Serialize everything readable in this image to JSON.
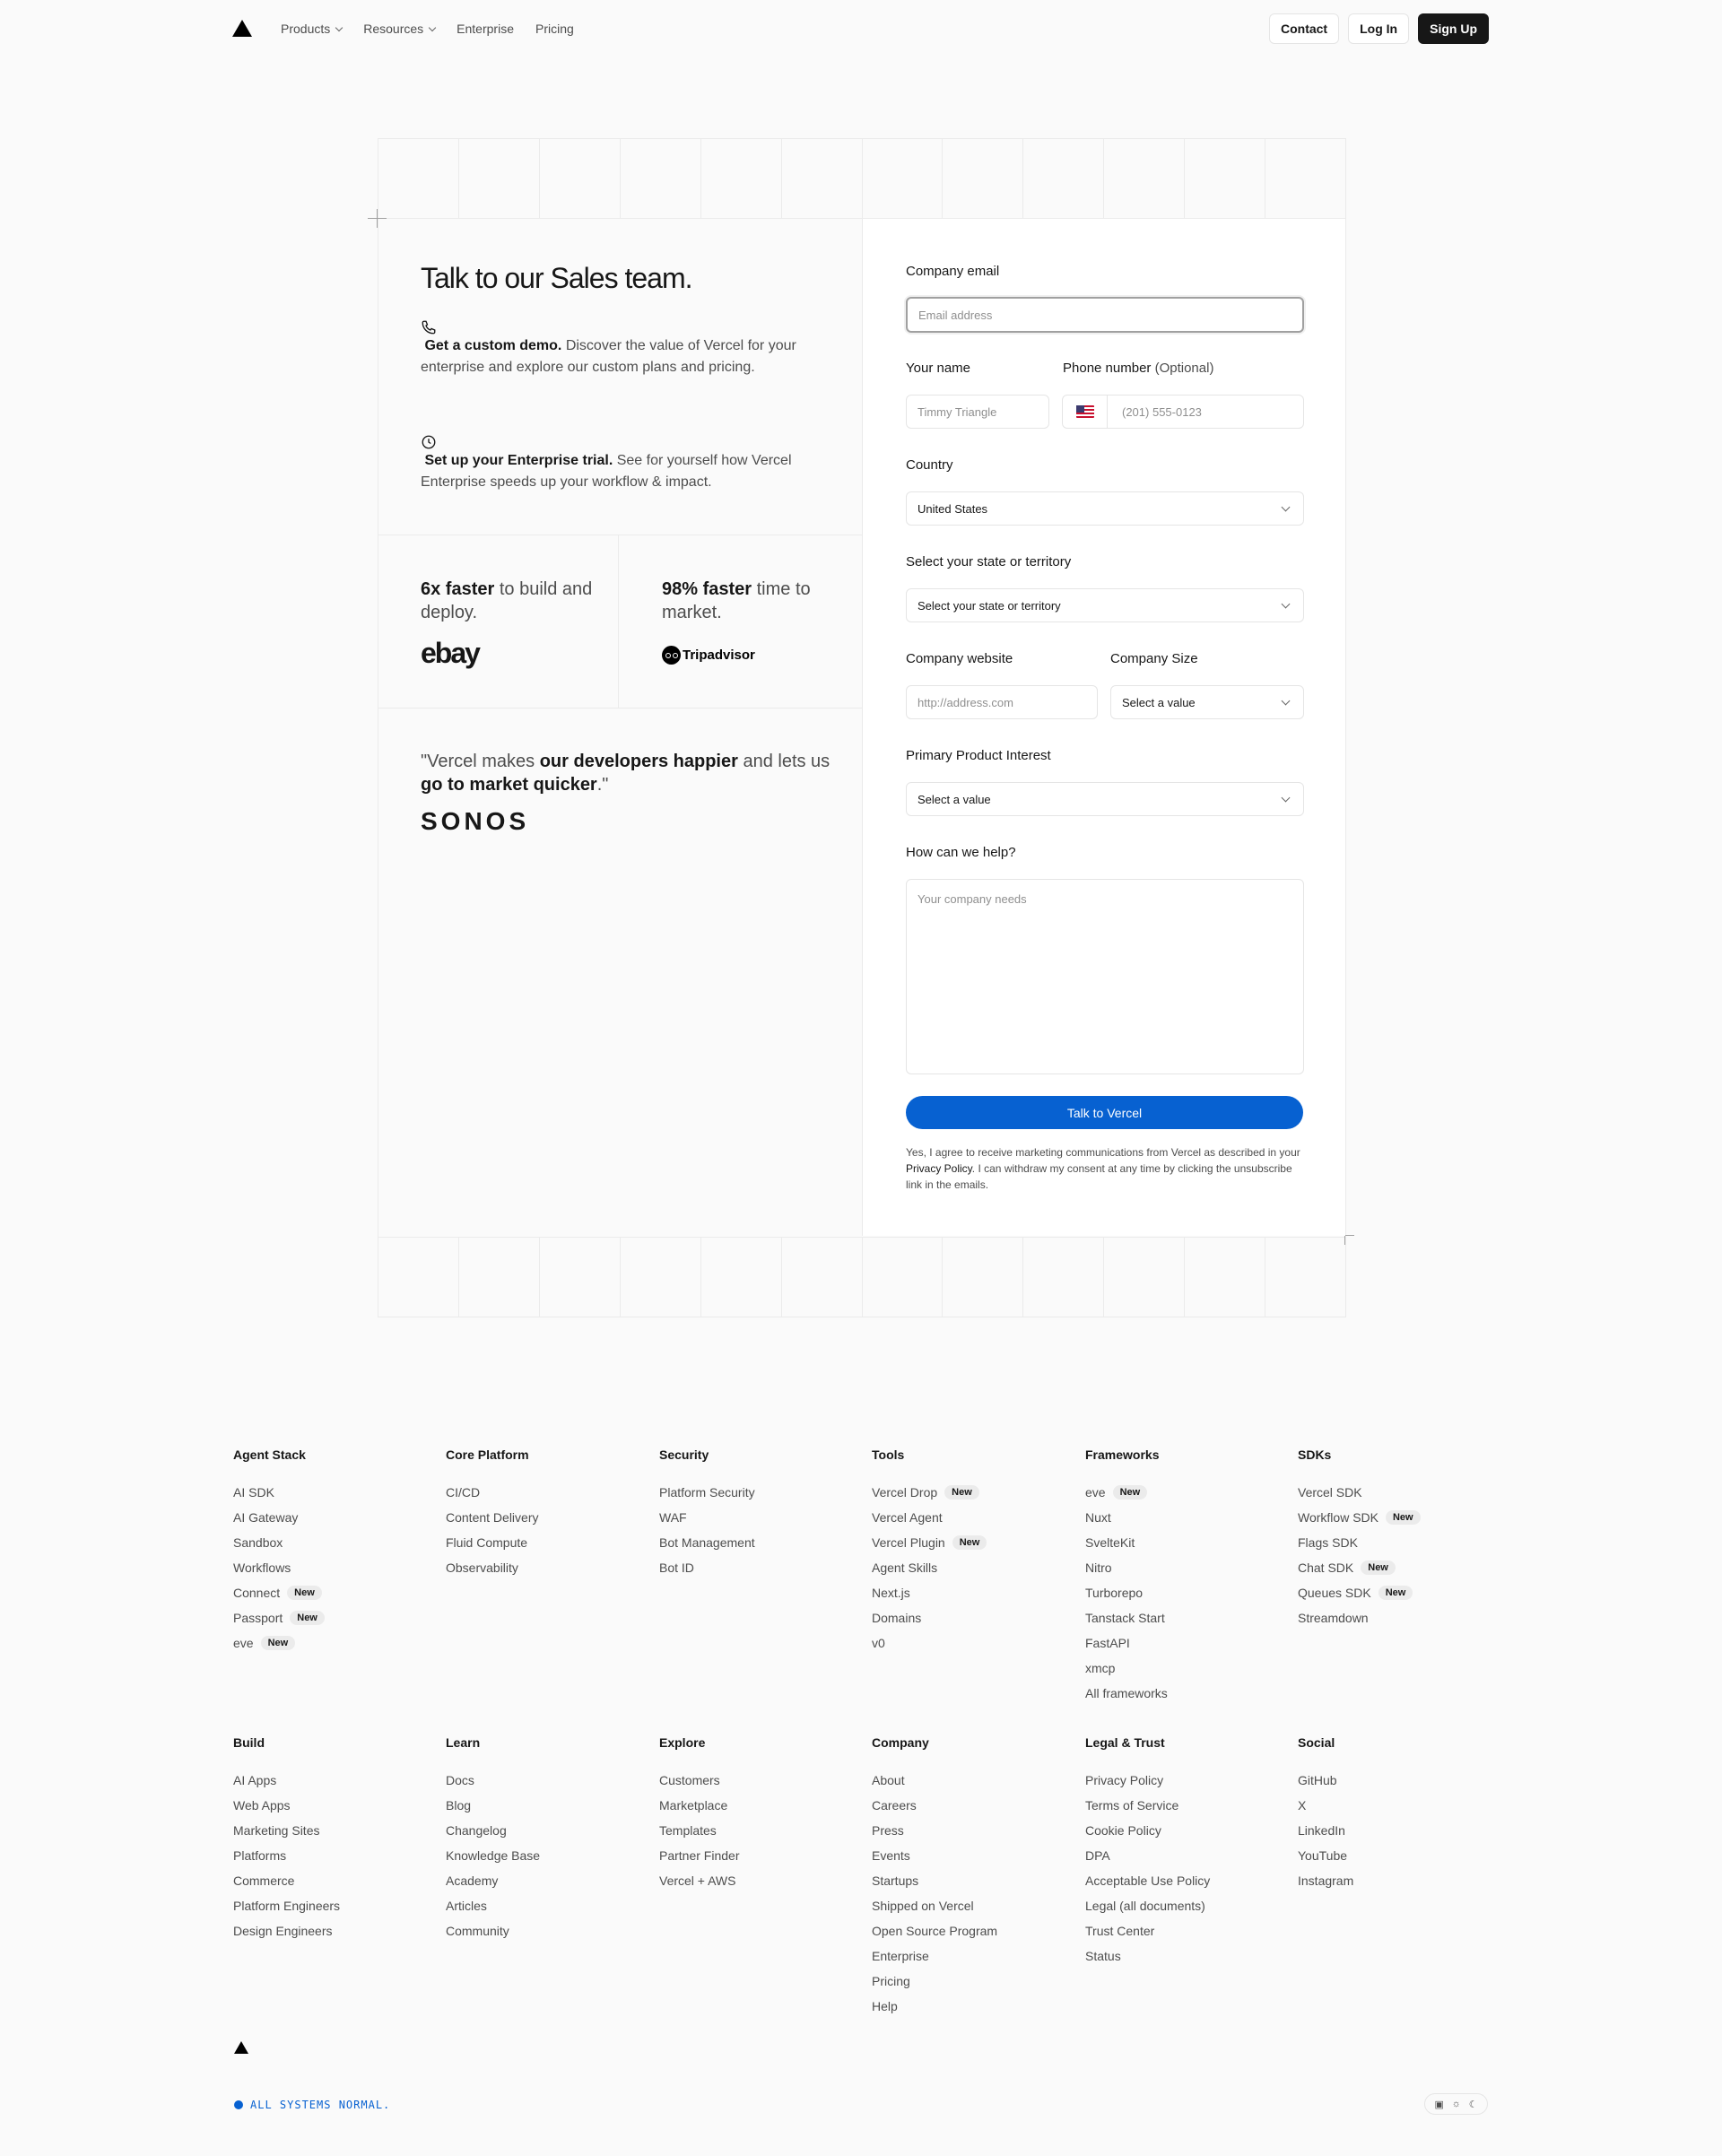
{
  "nav": {
    "items": [
      {
        "label": "Products",
        "has_menu": true
      },
      {
        "label": "Resources",
        "has_menu": true
      },
      {
        "label": "Enterprise",
        "has_menu": false
      },
      {
        "label": "Pricing",
        "has_menu": false
      }
    ],
    "contact": "Contact",
    "login": "Log In",
    "signup": "Sign Up"
  },
  "hero": {
    "title": "Talk to our Sales team.",
    "feature1_bold": "Get a custom demo.",
    "feature1_text": " Discover the value of Vercel for your enterprise and explore our custom plans and pricing.",
    "feature2_bold": "Set up your Enterprise trial.",
    "feature2_text": " See for yourself how Vercel Enterprise speeds up your workflow & impact.",
    "stat1_bold": "6x faster",
    "stat1_text": " to build and deploy.",
    "stat1_logo": "ebay",
    "stat2_bold": "98% faster",
    "stat2_text": " time to market.",
    "stat2_logo": "Tripadvisor",
    "quote_a": "\"Vercel makes ",
    "quote_b": "our developers happier",
    "quote_c": " and lets us ",
    "quote_d": "go to market quicker",
    "quote_e": ".\"",
    "quote_logo": "SONOS"
  },
  "form": {
    "email_label": "Company email",
    "email_placeholder": "Email address",
    "name_label": "Your name",
    "name_placeholder": "Timmy Triangle",
    "phone_label": "Phone number",
    "phone_optional": "(Optional)",
    "phone_placeholder": "(201) 555-0123",
    "country_label": "Country",
    "country_value": "United States",
    "state_label": "Select your state or territory",
    "state_placeholder": "Select your state or territory",
    "website_label": "Company website",
    "website_placeholder": "http://address.com",
    "size_label": "Company Size",
    "size_placeholder": "Select a value",
    "product_label": "Primary Product Interest",
    "product_placeholder": "Select a value",
    "help_label": "How can we help?",
    "help_placeholder": "Your company needs",
    "submit": "Talk to Vercel",
    "legal_a": "Yes, I agree to receive marketing communications from Vercel as described in your ",
    "legal_link": "Privacy Policy",
    "legal_b": ". I can withdraw my consent at any time by clicking the unsubscribe link in the emails."
  },
  "footer": {
    "columns": [
      {
        "title": "Agent Stack",
        "items": [
          {
            "label": "AI SDK"
          },
          {
            "label": "AI Gateway"
          },
          {
            "label": "Sandbox"
          },
          {
            "label": "Workflows"
          },
          {
            "label": "Connect",
            "badge": "New"
          },
          {
            "label": "Passport",
            "badge": "New"
          },
          {
            "label": "eve",
            "badge": "New"
          }
        ]
      },
      {
        "title": "Core Platform",
        "items": [
          {
            "label": "CI/CD"
          },
          {
            "label": "Content Delivery"
          },
          {
            "label": "Fluid Compute"
          },
          {
            "label": "Observability"
          }
        ]
      },
      {
        "title": "Security",
        "items": [
          {
            "label": "Platform Security"
          },
          {
            "label": "WAF"
          },
          {
            "label": "Bot Management"
          },
          {
            "label": "Bot ID"
          }
        ]
      },
      {
        "title": "Tools",
        "items": [
          {
            "label": "Vercel Drop",
            "badge": "New"
          },
          {
            "label": "Vercel Agent"
          },
          {
            "label": "Vercel Plugin",
            "badge": "New"
          },
          {
            "label": "Agent Skills"
          },
          {
            "label": "Next.js"
          },
          {
            "label": "Domains"
          },
          {
            "label": "v0"
          }
        ]
      },
      {
        "title": "Frameworks",
        "items": [
          {
            "label": "eve",
            "badge": "New"
          },
          {
            "label": "Nuxt"
          },
          {
            "label": "SvelteKit"
          },
          {
            "label": "Nitro"
          },
          {
            "label": "Turborepo"
          },
          {
            "label": "Tanstack Start"
          },
          {
            "label": "FastAPI"
          },
          {
            "label": "xmcp"
          },
          {
            "label": "All frameworks"
          }
        ]
      },
      {
        "title": "SDKs",
        "items": [
          {
            "label": "Vercel SDK"
          },
          {
            "label": "Workflow SDK",
            "badge": "New"
          },
          {
            "label": "Flags SDK"
          },
          {
            "label": "Chat SDK",
            "badge": "New"
          },
          {
            "label": "Queues SDK",
            "badge": "New"
          },
          {
            "label": "Streamdown"
          }
        ]
      },
      {
        "title": "Build",
        "items": [
          {
            "label": "AI Apps"
          },
          {
            "label": "Web Apps"
          },
          {
            "label": "Marketing Sites"
          },
          {
            "label": "Platforms"
          },
          {
            "label": "Commerce"
          },
          {
            "label": "Platform Engineers"
          },
          {
            "label": "Design Engineers"
          }
        ]
      },
      {
        "title": "Learn",
        "items": [
          {
            "label": "Docs"
          },
          {
            "label": "Blog"
          },
          {
            "label": "Changelog"
          },
          {
            "label": "Knowledge Base"
          },
          {
            "label": "Academy"
          },
          {
            "label": "Articles"
          },
          {
            "label": "Community"
          }
        ]
      },
      {
        "title": "Explore",
        "items": [
          {
            "label": "Customers"
          },
          {
            "label": "Marketplace"
          },
          {
            "label": "Templates"
          },
          {
            "label": "Partner Finder"
          },
          {
            "label": "Vercel + AWS"
          }
        ]
      },
      {
        "title": "Company",
        "items": [
          {
            "label": "About"
          },
          {
            "label": "Careers"
          },
          {
            "label": "Press"
          },
          {
            "label": "Events"
          },
          {
            "label": "Startups"
          },
          {
            "label": "Shipped on Vercel"
          },
          {
            "label": "Open Source Program"
          },
          {
            "label": "Enterprise"
          },
          {
            "label": "Pricing"
          },
          {
            "label": "Help"
          }
        ]
      },
      {
        "title": "Legal & Trust",
        "items": [
          {
            "label": "Privacy Policy"
          },
          {
            "label": "Terms of Service"
          },
          {
            "label": "Cookie Policy"
          },
          {
            "label": "DPA"
          },
          {
            "label": "Acceptable Use Policy"
          },
          {
            "label": "Legal (all documents)"
          },
          {
            "label": "Trust Center"
          },
          {
            "label": "Status"
          }
        ]
      },
      {
        "title": "Social",
        "items": [
          {
            "label": "GitHub"
          },
          {
            "label": "X"
          },
          {
            "label": "LinkedIn"
          },
          {
            "label": "YouTube"
          },
          {
            "label": "Instagram"
          }
        ]
      }
    ],
    "status": "ALL SYSTEMS NORMAL.",
    "theme_icons": [
      "monitor-icon",
      "sun-icon",
      "moon-icon"
    ],
    "accent": "#0761d1"
  }
}
